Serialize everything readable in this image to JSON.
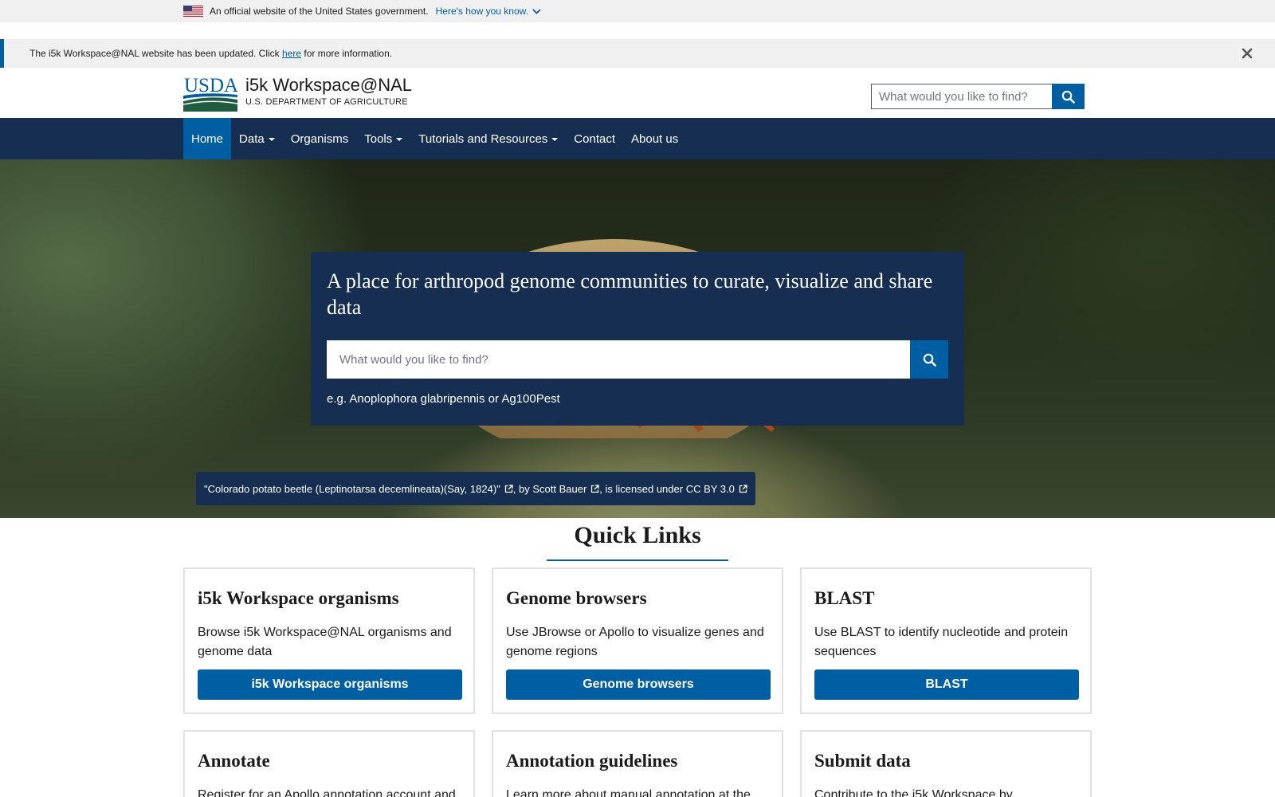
{
  "gov_banner": {
    "text": "An official website of the United States government.",
    "link": "Here's how you know."
  },
  "alert": {
    "text_before": "The i5k Workspace@NAL website has been updated. Click ",
    "link": "here",
    "text_after": " for more information."
  },
  "header": {
    "logo_text": "USDA",
    "site_title": "i5k Workspace@NAL",
    "site_subtitle": "U.S. DEPARTMENT OF AGRICULTURE",
    "search_placeholder": "What would you like to find?"
  },
  "nav": {
    "items": [
      {
        "label": "Home",
        "active": true
      },
      {
        "label": "Data",
        "dropdown": true
      },
      {
        "label": "Organisms"
      },
      {
        "label": "Tools",
        "dropdown": true
      },
      {
        "label": "Tutorials and Resources",
        "dropdown": true
      },
      {
        "label": "Contact"
      },
      {
        "label": "About us"
      }
    ]
  },
  "hero": {
    "title": "A place for arthropod genome communities to curate, visualize and share data",
    "search_placeholder": "What would you like to find?",
    "example": "e.g. Anoplophora glabripennis or Ag100Pest",
    "credit": {
      "work": "\"Colorado potato beetle (Leptinotarsa decemlineata)(Say, 1824)\"",
      "by": ", by ",
      "author": "Scott Bauer",
      "licensed": ", is licensed under ",
      "license": "CC BY 3.0"
    }
  },
  "quick_links": {
    "title": "Quick Links",
    "cards": [
      {
        "title": "i5k Workspace organisms",
        "text": "Browse i5k Workspace@NAL organisms and genome data",
        "button": "i5k Workspace organisms"
      },
      {
        "title": "Genome browsers",
        "text": "Use JBrowse or Apollo to visualize genes and genome regions",
        "button": "Genome browsers"
      },
      {
        "title": "BLAST",
        "text": "Use BLAST to identify nucleotide and protein sequences",
        "button": "BLAST"
      },
      {
        "title": "Annotate",
        "text": "Register for an Apollo annotation account and"
      },
      {
        "title": "Annotation guidelines",
        "text": "Learn more about manual annotation at the"
      },
      {
        "title": "Submit data",
        "text": "Contribute to the i5k Workspace by"
      }
    ]
  },
  "colors": {
    "primary": "#005ea2",
    "navy": "#162e51",
    "banner_bg": "#f0f0f0"
  }
}
